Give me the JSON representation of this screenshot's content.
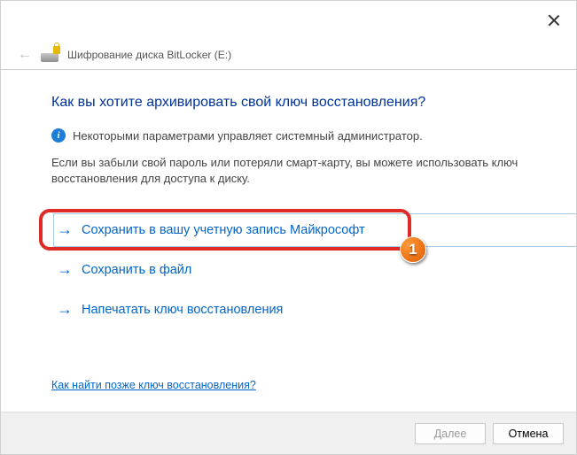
{
  "header": {
    "title": "Шифрование диска BitLocker (E:)"
  },
  "content": {
    "heading": "Как вы хотите архивировать свой ключ восстановления?",
    "info_text": "Некоторыми параметрами управляет системный администратор.",
    "body_text": "Если вы забыли свой пароль или потеряли смарт-карту, вы можете использовать ключ восстановления для доступа к диску.",
    "options": {
      "save_ms": "Сохранить в вашу учетную запись Майкрософт",
      "save_file": "Сохранить в файл",
      "print_key": "Напечатать ключ восстановления"
    },
    "help_link": "Как найти позже ключ восстановления?"
  },
  "footer": {
    "next": "Далее",
    "cancel": "Отмена"
  },
  "annotation": {
    "marker": "1"
  }
}
